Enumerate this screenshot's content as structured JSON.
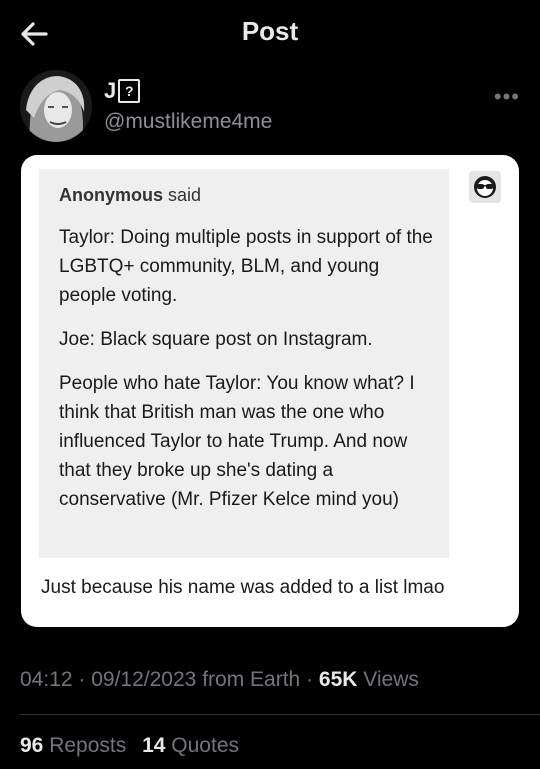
{
  "header": {
    "title": "Post",
    "back_icon": "arrow-left-icon"
  },
  "author": {
    "name": "J",
    "name_icon": "question-box-icon",
    "handle": "@mustlikeme4me"
  },
  "more_icon": "more-dots-icon",
  "card": {
    "quote": {
      "author": "Anonymous",
      "said": "said",
      "paragraphs": [
        "Taylor: Doing multiple posts in support of the LGBTQ+ community, BLM, and young people voting.",
        "Joe: Black square post on Instagram.",
        "People who hate Taylor: You know what? I think that British man was the one who influenced Taylor to hate Trump. And now that they broke up she's dating a conservative (Mr. Pfizer Kelce mind you)"
      ]
    },
    "anon_icon": "sunglasses-avatar-icon",
    "reply": "Just because his name was added to a list lmao"
  },
  "meta": {
    "time": "04:12",
    "date": "09/12/2023",
    "location": "from Earth",
    "views_count": "65K",
    "views_label": "Views"
  },
  "stats": {
    "reposts_count": "96",
    "reposts_label": "Reposts",
    "quotes_count": "14",
    "quotes_label": "Quotes"
  },
  "colors": {
    "background": "#000000",
    "card": "#ffffff",
    "quote_bg": "#efefef",
    "muted": "#71767b"
  }
}
